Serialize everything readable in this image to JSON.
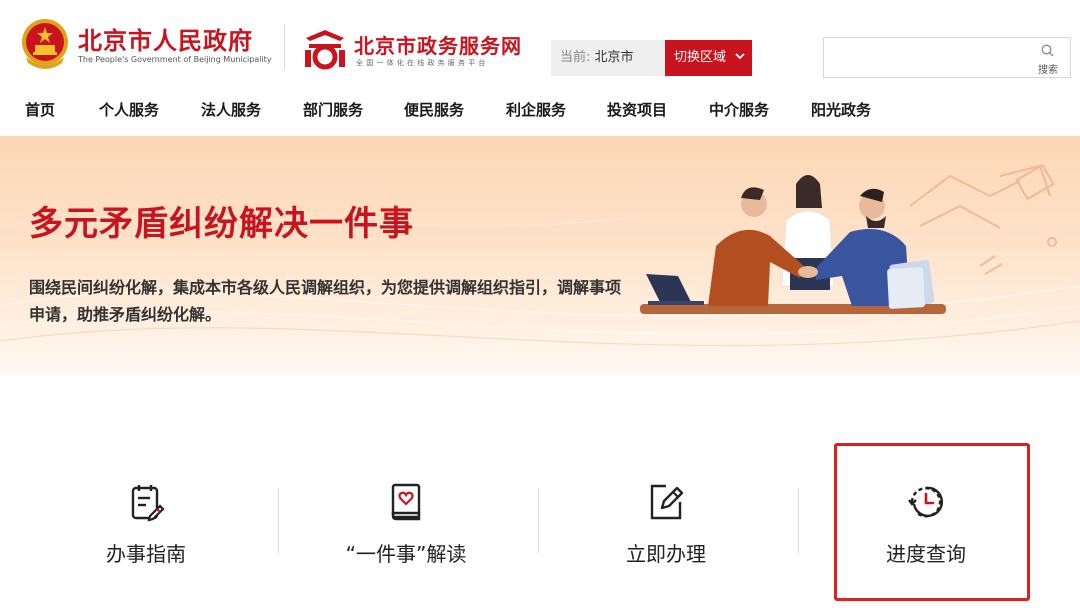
{
  "header": {
    "gov_name": "北京市人民政府",
    "gov_subtitle": "The People's Government of Beijing Municipality",
    "portal_name": "北京市政务服务网",
    "portal_subtitle": "全国一体化在线政务服务平台",
    "region_prefix": "当前:",
    "region_city": "北京市",
    "switch_region_label": "切换区域",
    "search_placeholder": "",
    "search_label": "搜索"
  },
  "nav": {
    "items": [
      {
        "label": "首页"
      },
      {
        "label": "个人服务"
      },
      {
        "label": "法人服务"
      },
      {
        "label": "部门服务"
      },
      {
        "label": "便民服务"
      },
      {
        "label": "利企服务"
      },
      {
        "label": "投资项目"
      },
      {
        "label": "中介服务"
      },
      {
        "label": "阳光政务"
      }
    ]
  },
  "banner": {
    "title": "多元矛盾纠纷解决一件事",
    "description": "围绕民间纠纷化解，集成本市各级人民调解组织，为您提供调解组织指引，调解事项申请，助推矛盾纠纷化解。"
  },
  "features": [
    {
      "label": "办事指南",
      "icon": "guide-clipboard-icon"
    },
    {
      "label": "“一件事”解读",
      "icon": "book-heart-icon"
    },
    {
      "label": "立即办理",
      "icon": "edit-pen-icon"
    },
    {
      "label": "进度查询",
      "icon": "history-clock-icon"
    }
  ],
  "colors": {
    "brand_red": "#c8141e",
    "highlight_red": "#e0201e"
  }
}
